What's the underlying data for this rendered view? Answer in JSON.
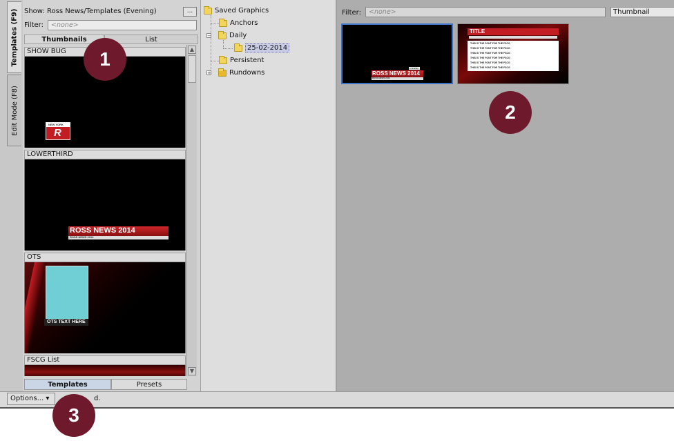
{
  "vertical_tabs": {
    "templates": "Templates (F9)",
    "edit_mode": "Edit Mode (F8)"
  },
  "left": {
    "show_label": "Show:",
    "show_value": "Ross News/Templates (Evening)",
    "more_button": "...",
    "filter_label": "Filter:",
    "filter_placeholder": "<none>",
    "view_tabs": [
      "Thumbnails",
      "List"
    ],
    "templates": [
      {
        "label": "SHOW BUG",
        "logo_text": "R",
        "small_text": "NEW YORK"
      },
      {
        "label": "LOWERTHIRD",
        "title": "ROSS NEWS 2014",
        "subtitle": "ROSS NEWS 2014"
      },
      {
        "label": "OTS",
        "box_text": "OTS TEXT HERE"
      },
      {
        "label": "FSCG List"
      }
    ],
    "bottom_tabs": [
      "Templates",
      "Presets"
    ]
  },
  "tree": {
    "root": "Saved Graphics",
    "children": [
      "Anchors",
      "Daily",
      "25-02-2014",
      "Persistent",
      "Rundowns"
    ]
  },
  "right": {
    "filter_label": "Filter:",
    "filter_placeholder": "<none>",
    "view_select": "Thumbnail",
    "thumbs": [
      {
        "title": "ROSS NEWS 2014",
        "subtitle": "ROSS NEWS 2014",
        "tag": "EVENING"
      },
      {
        "title": "TITLE",
        "lines": [
          "THIS IS THE FONT FOR THE FSCG",
          "THIS IS THE FONT FOR THE FSCG",
          "THIS IS THE FONT FOR THE FSCG",
          "THIS IS THE FONT FOR THE FSCG",
          "THIS IS THE FONT FOR THE FSCG",
          "THIS IS THE FONT FOR THE FSCG"
        ]
      }
    ]
  },
  "status": {
    "options_label": "Options...",
    "status_text": "d."
  },
  "callouts": [
    "1",
    "2",
    "3"
  ]
}
